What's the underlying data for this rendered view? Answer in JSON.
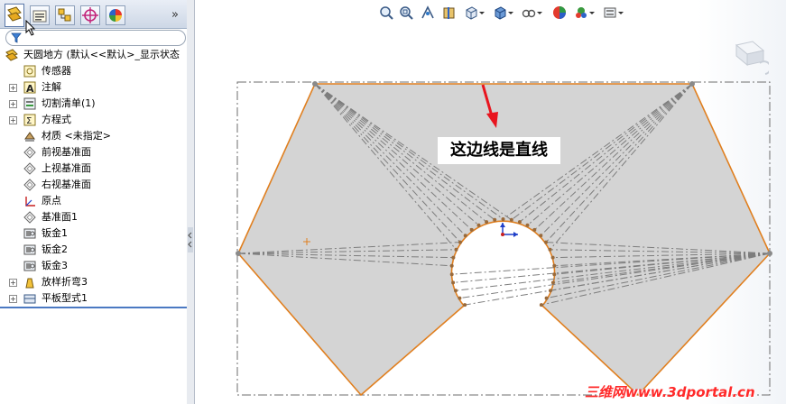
{
  "tabs": [
    {
      "name": "feature-manager"
    },
    {
      "name": "property-manager"
    },
    {
      "name": "configuration-manager"
    },
    {
      "name": "dimxpert-manager"
    },
    {
      "name": "display-manager"
    }
  ],
  "tree": {
    "root_label": "天圆地方  (默认<<默认>_显示状态",
    "items": [
      {
        "label": "传感器",
        "icon": "sensor-icon",
        "expandable": false
      },
      {
        "label": "注解",
        "icon": "annotations-icon",
        "expandable": true
      },
      {
        "label": "切割清单(1)",
        "icon": "cut-list-icon",
        "expandable": true
      },
      {
        "label": "方程式",
        "icon": "equations-icon",
        "expandable": true
      },
      {
        "label": "材质 <未指定>",
        "icon": "material-icon",
        "expandable": false
      },
      {
        "label": "前视基准面",
        "icon": "plane-icon",
        "expandable": false
      },
      {
        "label": "上视基准面",
        "icon": "plane-icon",
        "expandable": false
      },
      {
        "label": "右视基准面",
        "icon": "plane-icon",
        "expandable": false
      },
      {
        "label": "原点",
        "icon": "origin-icon",
        "expandable": false
      },
      {
        "label": "基准面1",
        "icon": "plane-icon",
        "expandable": false
      },
      {
        "label": "钣金1",
        "icon": "sheet-metal-icon",
        "expandable": false
      },
      {
        "label": "钣金2",
        "icon": "sheet-metal-icon",
        "expandable": false
      },
      {
        "label": "钣金3",
        "icon": "sheet-metal-icon",
        "expandable": false
      },
      {
        "label": "放样折弯3",
        "icon": "lofted-bend-icon",
        "expandable": true
      },
      {
        "label": "平板型式1",
        "icon": "flat-pattern-icon",
        "expandable": true
      }
    ]
  },
  "toolbar": {
    "icons": [
      "zoom-to-fit-icon",
      "zoom-to-area-icon",
      "previous-view-icon",
      "section-view-icon",
      "view-orientation-icon",
      "display-style-icon",
      "hide-show-items-icon",
      "edit-appearance-icon",
      "apply-scene-icon",
      "view-settings-icon"
    ]
  },
  "annotation": {
    "text": "这边线是直线",
    "arrow_color": "#e8141e"
  },
  "watermark": {
    "text": "三维网www.3dportal.cn"
  },
  "colors": {
    "part_fill": "#d4d4d4",
    "edge": "#e07f1f",
    "bend_lines": "#7d7d7d",
    "bbox": "#6e6e6e"
  }
}
